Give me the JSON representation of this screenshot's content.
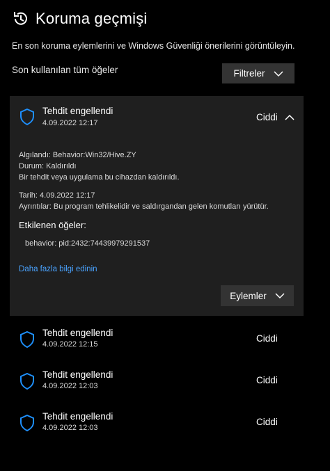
{
  "header": {
    "title": "Koruma geçmişi",
    "subtitle": "En son koruma eylemlerini ve Windows Güvenliği önerilerini görüntüleyin."
  },
  "filter": {
    "section_label": "Son kullanılan tüm öğeler",
    "button_label": "Filtreler"
  },
  "expanded_item": {
    "title": "Tehdit engellendi",
    "date": "4.09.2022 12:17",
    "severity": "Ciddi",
    "detected": "Algılandı: Behavior:Win32/Hive.ZY",
    "status": "Durum:  Kaldırıldı",
    "status_note": "Bir tehdit veya uygulama bu cihazdan kaldırıldı.",
    "date_line": "Tarih:  4.09.2022 12:17",
    "details": "Ayrıntılar: Bu program tehlikelidir ve saldırgandan gelen komutları yürütür.",
    "affected_title": "Etkilenen öğeler:",
    "affected_item": "behavior: pid:2432:74439979291537",
    "more_link": "Daha fazla bilgi edinin",
    "actions_label": "Eylemler"
  },
  "items": [
    {
      "title": "Tehdit engellendi",
      "date": "4.09.2022 12:15",
      "severity": "Ciddi"
    },
    {
      "title": "Tehdit engellendi",
      "date": "4.09.2022 12:03",
      "severity": "Ciddi"
    },
    {
      "title": "Tehdit engellendi",
      "date": "4.09.2022 12:03",
      "severity": "Ciddi"
    }
  ],
  "colors": {
    "background": "#000000",
    "card": "#1f1f1f",
    "button": "#333333",
    "accent_link": "#4aa3ff",
    "shield": "#1e90ff"
  },
  "icons": {
    "header": "history-icon",
    "item": "shield-icon",
    "expand": "chevron-up-icon",
    "dropdown": "chevron-down-icon"
  }
}
